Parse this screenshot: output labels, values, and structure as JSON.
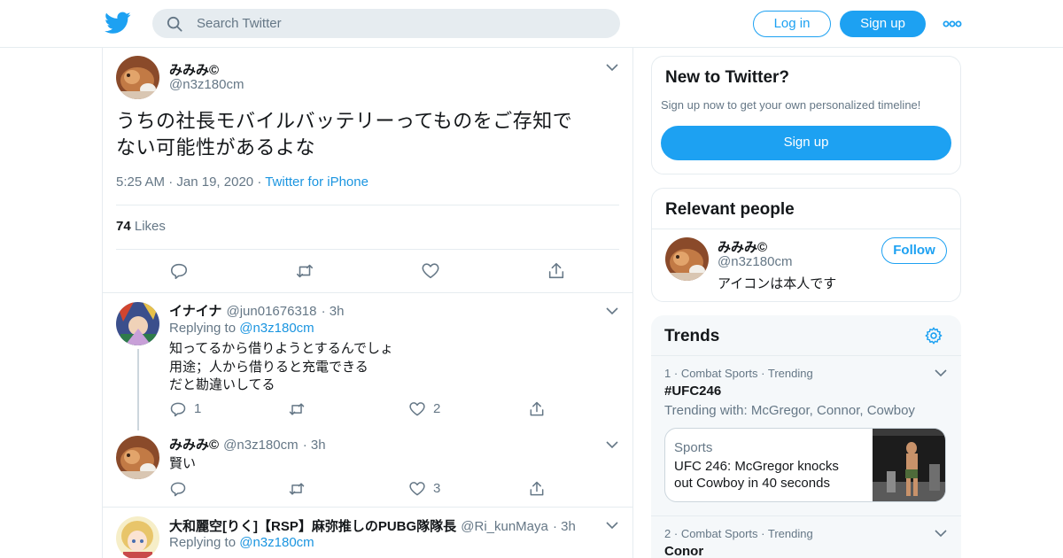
{
  "header": {
    "search_placeholder": "Search Twitter",
    "login_label": "Log in",
    "signup_label": "Sign up"
  },
  "tweet": {
    "author_name": "みみみ©",
    "author_handle": "@n3z180cm",
    "text_line1": "うちの社長モバイルバッテリーってものをご存知で",
    "text_line2": "ない可能性があるよな",
    "time": "5:25 AM",
    "date": "Jan 19, 2020",
    "source": "Twitter for iPhone",
    "likes_count": "74",
    "likes_label": "Likes"
  },
  "replies": [
    {
      "name": "イナイナ",
      "handle": "@jun01676318",
      "time": "3h",
      "replying_prefix": "Replying to",
      "replying_to": "@n3z180cm",
      "lines": [
        "知ってるから借りようとするんでしょ",
        "用途；人から借りると充電できる",
        "だと勘違いしてる"
      ],
      "reply_count": "1",
      "like_count": "2"
    },
    {
      "name": "みみみ©",
      "handle": "@n3z180cm",
      "time": "3h",
      "lines": [
        "賢い"
      ],
      "reply_count": "",
      "like_count": "3"
    },
    {
      "name": "大和麗空[りく]【RSP】麻弥推しのPUBG隊隊長",
      "handle": "@Ri_kunMaya",
      "time": "3h",
      "replying_prefix": "Replying to",
      "replying_to": "@n3z180cm"
    }
  ],
  "new_to_twitter": {
    "title": "New to Twitter?",
    "subtitle": "Sign up now to get your own personalized timeline!",
    "signup_label": "Sign up"
  },
  "relevant_people": {
    "title": "Relevant people",
    "name": "みみみ©",
    "handle": "@n3z180cm",
    "bio": "アイコンは本人です",
    "follow_label": "Follow"
  },
  "trends": {
    "title": "Trends",
    "items": [
      {
        "rank": "1",
        "category": "Combat Sports",
        "status": "Trending",
        "name": "#UFC246",
        "with": "Trending with: McGregor, Connor, Cowboy",
        "news_category": "Sports",
        "news_line1": "UFC 246: McGregor knocks",
        "news_line2": "out Cowboy in 40 seconds"
      },
      {
        "rank": "2",
        "category": "Combat Sports",
        "status": "Trending",
        "name": "Conor"
      }
    ]
  },
  "colors": {
    "accent": "#1da1f2",
    "link": "#1b95e0",
    "secondary_text": "#657786",
    "border": "#e6ecf0",
    "trends_bg": "#f5f8fa"
  },
  "icons": [
    "twitter-bird-icon",
    "search-icon",
    "more-dots-icon",
    "chevron-down-icon",
    "reply-icon",
    "retweet-icon",
    "like-icon",
    "share-icon",
    "settings-gear-icon"
  ]
}
